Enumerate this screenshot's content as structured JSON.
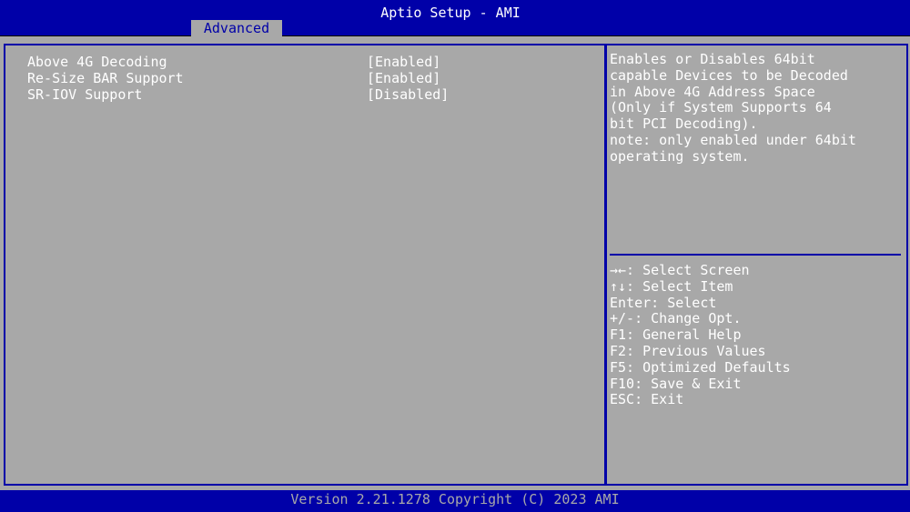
{
  "header": {
    "title": "Aptio Setup - AMI",
    "tabs": [
      {
        "label": "Advanced",
        "active": true
      }
    ]
  },
  "settings": [
    {
      "label": "Above 4G Decoding",
      "value": "[Enabled]"
    },
    {
      "label": "Re-Size BAR Support",
      "value": "[Enabled]"
    },
    {
      "label": "SR-IOV Support",
      "value": "[Disabled]"
    }
  ],
  "help": {
    "text": "Enables or Disables 64bit\ncapable Devices to be Decoded\nin Above 4G Address Space\n(Only if System Supports 64\nbit PCI Decoding).\nnote: only enabled under 64bit\noperating system."
  },
  "keys": [
    "→←: Select Screen",
    "↑↓: Select Item",
    "Enter: Select",
    "+/-: Change Opt.",
    "F1: General Help",
    "F2: Previous Values",
    "F5: Optimized Defaults",
    "F10: Save & Exit",
    "ESC: Exit"
  ],
  "footer": {
    "copyright": "Version 2.21.1278 Copyright (C) 2023 AMI"
  },
  "colors": {
    "bios_blue": "#0000a8",
    "bios_gray": "#a8a8a8",
    "text_white": "#ffffff"
  }
}
